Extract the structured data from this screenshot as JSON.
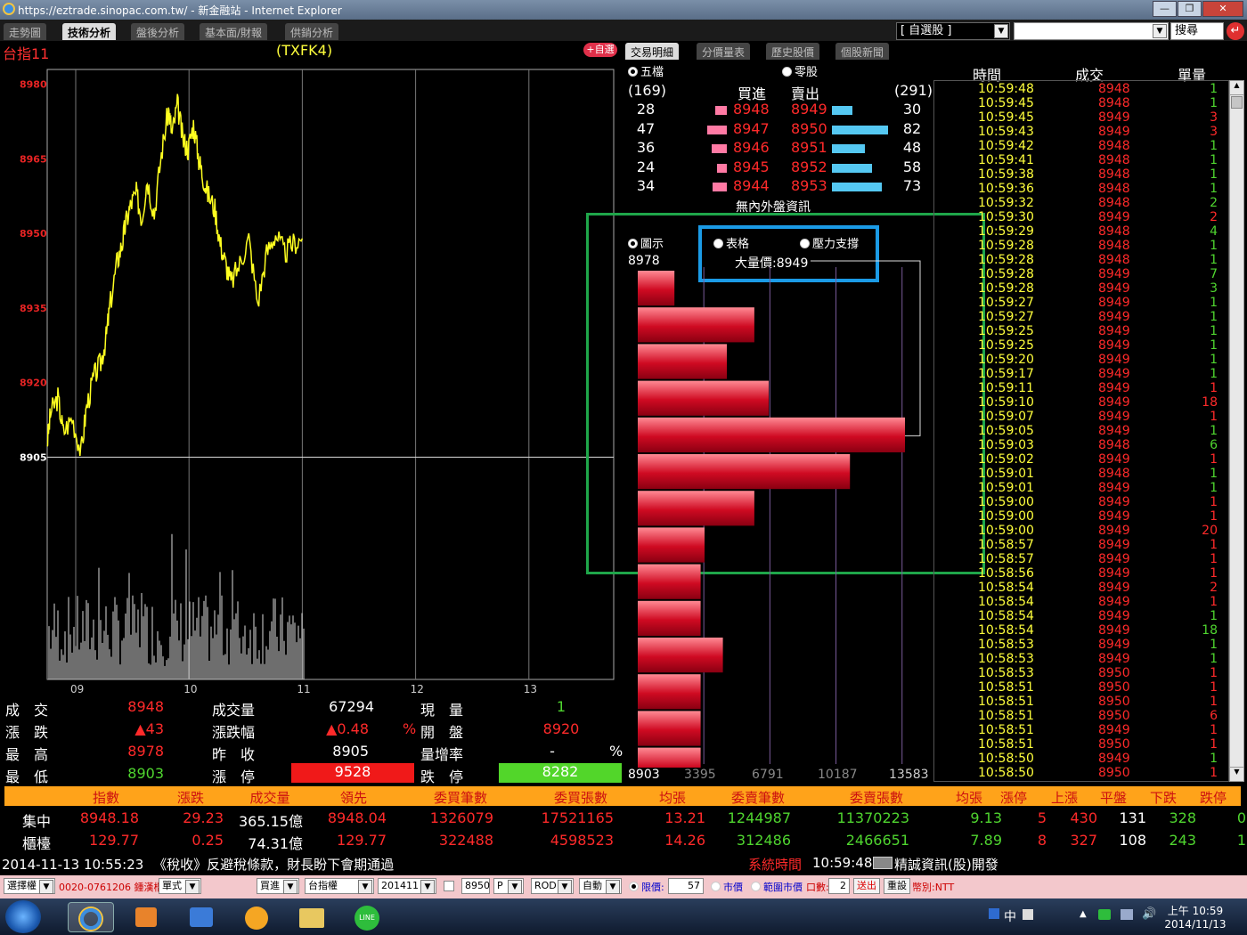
{
  "window": {
    "title": "https://eztrade.sinopac.com.tw/ - 新金融站 - Internet Explorer"
  },
  "tabs": [
    "走勢圖",
    "技術分析",
    "盤後分析",
    "基本面/財報",
    "供銷分析"
  ],
  "active_tab_index": 1,
  "top_right": {
    "list_select": "[ 自選股 ]",
    "search_label": "搜尋"
  },
  "chart_header": {
    "name": "台指11",
    "code": "(TXFK4)"
  },
  "panel_tabs": {
    "add_fav": "+自選",
    "items": [
      "交易明細",
      "分價量表",
      "歷史股價",
      "個股新聞"
    ]
  },
  "chart_data": {
    "type": "line",
    "title": "",
    "y_ticks": [
      "8980",
      "8965",
      "8950",
      "8935",
      "8920",
      "8905"
    ],
    "y_tick_values": [
      8980,
      8965,
      8950,
      8935,
      8920,
      8905
    ],
    "x_ticks": [
      "09",
      "10",
      "11",
      "12",
      "13"
    ],
    "ylim": [
      8897,
      8983
    ],
    "reference_line": 8905,
    "price_keypoints": {
      "x": [
        0,
        0.1,
        0.3,
        0.45,
        0.7,
        0.95,
        1.1,
        1.3,
        1.5,
        1.65,
        1.75,
        1.95,
        2.1,
        2.2,
        2.35,
        2.5,
        2.65,
        2.8,
        3.0,
        3.2,
        3.4,
        3.5,
        3.65,
        3.8,
        3.95,
        4.1,
        4.25,
        4.35,
        4.5,
        4.7,
        4.85,
        5.0,
        5.15,
        5.4,
        5.65,
        5.9,
        6.15,
        6.4,
        6.65,
        6.9,
        7.15
      ],
      "y": [
        8908,
        8914,
        8917,
        8910,
        8913,
        8906,
        8915,
        8921,
        8924,
        8929,
        8935,
        8944,
        8948,
        8952,
        8956,
        8958,
        8953,
        8961,
        8954,
        8966,
        8975,
        8970,
        8976,
        8969,
        8967,
        8972,
        8965,
        8962,
        8958,
        8955,
        8948,
        8944,
        8940,
        8944,
        8949,
        8936,
        8946,
        8950,
        8946,
        8948,
        8949
      ]
    },
    "volume_note": "volume bars"
  },
  "order_book": {
    "mode_five": "五檔",
    "mode_odd": "零股",
    "bid_total": "(169)",
    "bid_label": "買進",
    "ask_label": "賣出",
    "ask_total": "(291)",
    "rows": [
      {
        "bid_qty": "28",
        "bid": "8948",
        "ask": "8949",
        "ask_qty": "30",
        "bid_frac": 0.34,
        "ask_frac": 0.37
      },
      {
        "bid_qty": "47",
        "bid": "8947",
        "ask": "8950",
        "ask_qty": "82",
        "bid_frac": 0.57,
        "ask_frac": 1.0
      },
      {
        "bid_qty": "36",
        "bid": "8946",
        "ask": "8951",
        "ask_qty": "48",
        "bid_frac": 0.44,
        "ask_frac": 0.59
      },
      {
        "bid_qty": "24",
        "bid": "8945",
        "ask": "8952",
        "ask_qty": "58",
        "bid_frac": 0.29,
        "ask_frac": 0.71
      },
      {
        "bid_qty": "34",
        "bid": "8944",
        "ask": "8953",
        "ask_qty": "73",
        "bid_frac": 0.41,
        "ask_frac": 0.89
      }
    ],
    "note": "無內外盤資訊"
  },
  "volume_profile": {
    "mode_chart": "圖示",
    "mode_table": "表格",
    "mode_support": "壓力支撐",
    "top_price": "8978",
    "bottom_price": "8903",
    "big_volume_label": "大量價:8949",
    "axis_ticks": [
      "3395",
      "6791",
      "10187",
      "13583"
    ],
    "values": [
      2800,
      8900,
      6800,
      10000,
      20400,
      16200,
      8900,
      5100,
      4800,
      4800,
      6500,
      4800,
      4800,
      4800,
      700
    ],
    "max": 20400
  },
  "ticks_table": {
    "headers": [
      "時間",
      "成交",
      "單量"
    ],
    "rows": [
      [
        "10:59:48",
        "8948",
        "1"
      ],
      [
        "10:59:45",
        "8948",
        "1"
      ],
      [
        "10:59:45",
        "8949",
        "3"
      ],
      [
        "10:59:43",
        "8949",
        "3"
      ],
      [
        "10:59:42",
        "8948",
        "1"
      ],
      [
        "10:59:41",
        "8948",
        "1"
      ],
      [
        "10:59:38",
        "8948",
        "1"
      ],
      [
        "10:59:36",
        "8948",
        "1"
      ],
      [
        "10:59:32",
        "8948",
        "2"
      ],
      [
        "10:59:30",
        "8949",
        "2"
      ],
      [
        "10:59:29",
        "8948",
        "4"
      ],
      [
        "10:59:28",
        "8948",
        "1"
      ],
      [
        "10:59:28",
        "8948",
        "1"
      ],
      [
        "10:59:28",
        "8949",
        "7"
      ],
      [
        "10:59:28",
        "8949",
        "3"
      ],
      [
        "10:59:27",
        "8949",
        "1"
      ],
      [
        "10:59:27",
        "8949",
        "1"
      ],
      [
        "10:59:25",
        "8949",
        "1"
      ],
      [
        "10:59:25",
        "8949",
        "1"
      ],
      [
        "10:59:20",
        "8949",
        "1"
      ],
      [
        "10:59:17",
        "8949",
        "1"
      ],
      [
        "10:59:11",
        "8949",
        "1"
      ],
      [
        "10:59:10",
        "8949",
        "18"
      ],
      [
        "10:59:07",
        "8949",
        "1"
      ],
      [
        "10:59:05",
        "8949",
        "1"
      ],
      [
        "10:59:03",
        "8948",
        "6"
      ],
      [
        "10:59:02",
        "8949",
        "1"
      ],
      [
        "10:59:01",
        "8948",
        "1"
      ],
      [
        "10:59:01",
        "8949",
        "1"
      ],
      [
        "10:59:00",
        "8949",
        "1"
      ],
      [
        "10:59:00",
        "8949",
        "1"
      ],
      [
        "10:59:00",
        "8949",
        "20"
      ],
      [
        "10:58:57",
        "8949",
        "1"
      ],
      [
        "10:58:57",
        "8949",
        "1"
      ],
      [
        "10:58:56",
        "8949",
        "1"
      ],
      [
        "10:58:54",
        "8949",
        "2"
      ],
      [
        "10:58:54",
        "8949",
        "1"
      ],
      [
        "10:58:54",
        "8949",
        "1"
      ],
      [
        "10:58:54",
        "8949",
        "18"
      ],
      [
        "10:58:53",
        "8949",
        "1"
      ],
      [
        "10:58:53",
        "8949",
        "1"
      ],
      [
        "10:58:53",
        "8950",
        "1"
      ],
      [
        "10:58:51",
        "8950",
        "1"
      ],
      [
        "10:58:51",
        "8950",
        "1"
      ],
      [
        "10:58:51",
        "8950",
        "6"
      ],
      [
        "10:58:51",
        "8949",
        "1"
      ],
      [
        "10:58:51",
        "8950",
        "1"
      ],
      [
        "10:58:50",
        "8949",
        "1"
      ],
      [
        "10:58:50",
        "8950",
        "1"
      ]
    ],
    "row_colors": [
      "g",
      "g",
      "r",
      "r",
      "g",
      "g",
      "g",
      "g",
      "g",
      "r",
      "g",
      "g",
      "g",
      "g",
      "g",
      "g",
      "g",
      "g",
      "g",
      "g",
      "g",
      "r",
      "r",
      "r",
      "g",
      "g",
      "r",
      "g",
      "g",
      "r",
      "r",
      "r",
      "r",
      "r",
      "r",
      "r",
      "r",
      "g",
      "g",
      "g",
      "g",
      "r",
      "r",
      "r",
      "r",
      "r",
      "r",
      "g",
      "r"
    ]
  },
  "quote": {
    "deal_label": "成　交",
    "deal": "8948",
    "vol_label": "成交量",
    "vol": "67294",
    "cur_label": "現　量",
    "cur": "1",
    "chg_label": "漲　跌",
    "chg": "▲43",
    "chgpct_label": "漲跌幅",
    "chgpct": "▲0.48",
    "pct_sign": "%",
    "open_label": "開　盤",
    "open": "8920",
    "high_label": "最　高",
    "high": "8978",
    "prev_label": "昨　收",
    "prev": "8905",
    "volrate_label": "量增率",
    "volrate": "-",
    "volrate_pct": "%",
    "low_label": "最　低",
    "low": "8903",
    "limitup_label": "漲　停",
    "limitup": "9528",
    "limitdn_label": "跌　停",
    "limitdn": "8282"
  },
  "index_table": {
    "headers": [
      "指數",
      "漲跌",
      "成交量",
      "領先",
      "委買筆數",
      "委買張數",
      "均張",
      "委賣筆數",
      "委賣張數",
      "均張",
      "漲停",
      "上漲",
      "平盤",
      "下跌",
      "跌停"
    ],
    "rows": [
      {
        "name": "集中",
        "vals": [
          "8948.18",
          "29.23",
          "365.15億",
          "8948.04",
          "1326079",
          "17521165",
          "13.21",
          "1244987",
          "11370223",
          "9.13",
          "5",
          "430",
          "131",
          "328",
          "0"
        ]
      },
      {
        "name": "櫃檯",
        "vals": [
          "129.77",
          "0.25",
          "74.31億",
          "129.77",
          "322488",
          "4598523",
          "14.26",
          "312486",
          "2466651",
          "7.89",
          "8",
          "327",
          "108",
          "243",
          "1"
        ]
      }
    ]
  },
  "news_bar": {
    "time": "2014-11-13 10:55:23",
    "headline": "《稅收》反避稅條款，財長盼下會期通過",
    "sys_label": "系統時間",
    "sys_time": "10:59:48",
    "provider": "精誠資訊(股)開發"
  },
  "order_bar": {
    "account_select": "選擇權",
    "account": "0020-0761206 鍾漢楷",
    "type": "單式",
    "side": "買進",
    "product": "台指權",
    "month": "201411",
    "strike": "8950",
    "cp": "P",
    "cond": "ROD",
    "auto": "自動",
    "limit_label": "限價:",
    "limit_val": "57",
    "market_label": "市價",
    "range_label": "範圍市價",
    "qty_label": "口數:",
    "qty": "2",
    "send": "送出",
    "reset": "重設",
    "currency": "幣別:NTT"
  },
  "taskbar": {
    "ime": "中",
    "time": "上午 10:59",
    "date": "2014/11/13"
  }
}
